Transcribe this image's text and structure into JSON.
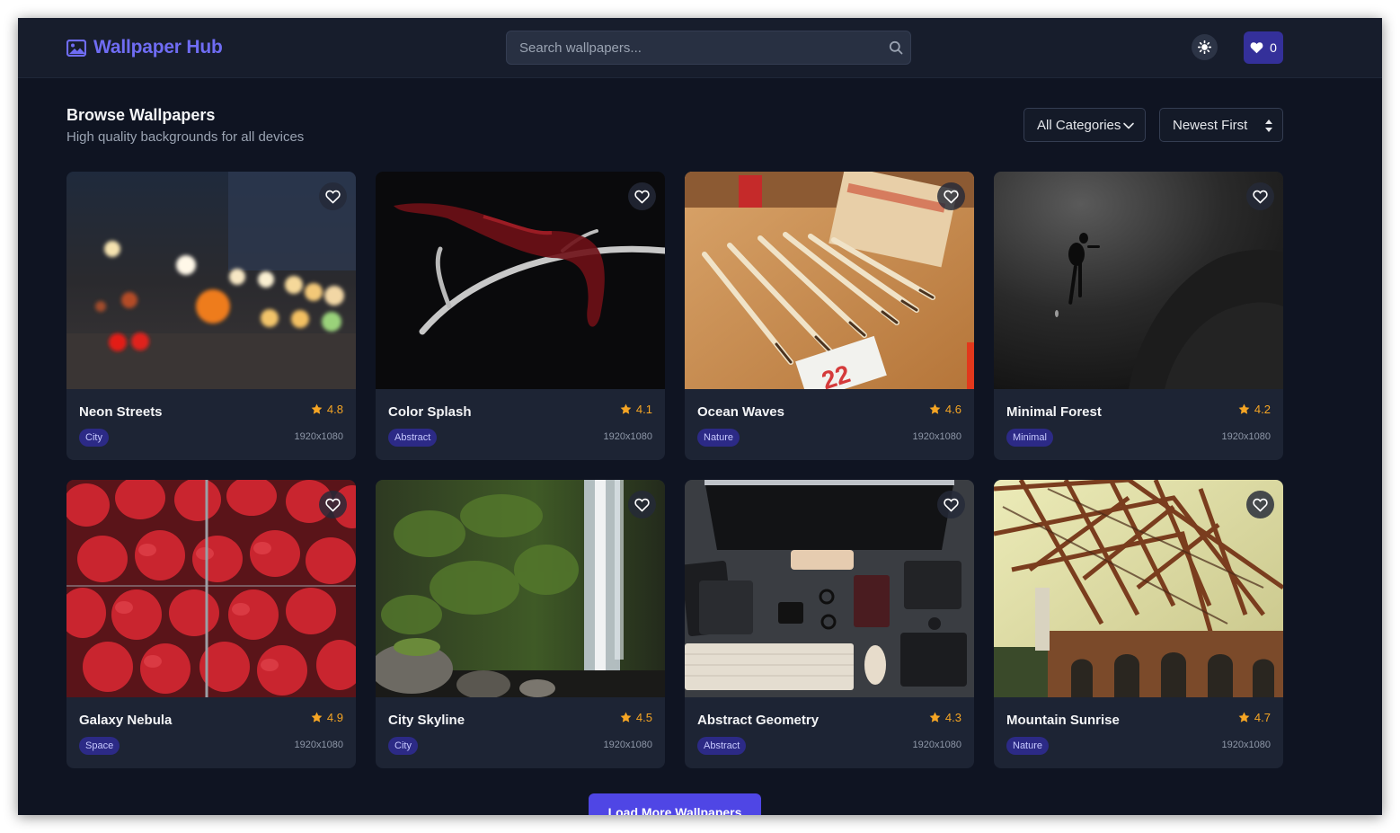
{
  "header": {
    "brand": "Wallpaper Hub",
    "search_placeholder": "Search wallpapers...",
    "favorites_count": "0"
  },
  "page": {
    "title": "Browse Wallpapers",
    "subtitle": "High quality backgrounds for all devices"
  },
  "filters": {
    "category_selected": "All Categories",
    "sort_selected": "Newest First"
  },
  "wallpapers": [
    {
      "title": "Neon Streets",
      "rating": "4.8",
      "category": "City",
      "resolution": "1920x1080",
      "photo": "blurred city lights bokeh"
    },
    {
      "title": "Color Splash",
      "rating": "4.1",
      "category": "Abstract",
      "resolution": "1920x1080",
      "photo": "antler with red ribbon on black"
    },
    {
      "title": "Ocean Waves",
      "rating": "4.6",
      "category": "Nature",
      "resolution": "1920x1080",
      "photo": "paint brushes on wooden table"
    },
    {
      "title": "Minimal Forest",
      "rating": "4.2",
      "category": "Minimal",
      "resolution": "1920x1080",
      "photo": "diver in dark water"
    },
    {
      "title": "Galaxy Nebula",
      "rating": "4.9",
      "category": "Space",
      "resolution": "1920x1080",
      "photo": "strawberries in crates"
    },
    {
      "title": "City Skyline",
      "rating": "4.5",
      "category": "City",
      "resolution": "1920x1080",
      "photo": "waterfall over mossy rock"
    },
    {
      "title": "Abstract Geometry",
      "rating": "4.3",
      "category": "Abstract",
      "resolution": "1920x1080",
      "photo": "desk flat lay with monitor and keyboard"
    },
    {
      "title": "Mountain Sunrise",
      "rating": "4.7",
      "category": "Nature",
      "resolution": "1920x1080",
      "photo": "steel bridge truss"
    }
  ],
  "load_more_label": "Load More Wallpapers",
  "colors": {
    "accent": "#6f6cf3",
    "button": "#4f46e5",
    "star": "#f5a524",
    "background": "#0f1422",
    "card": "#1d2434"
  }
}
